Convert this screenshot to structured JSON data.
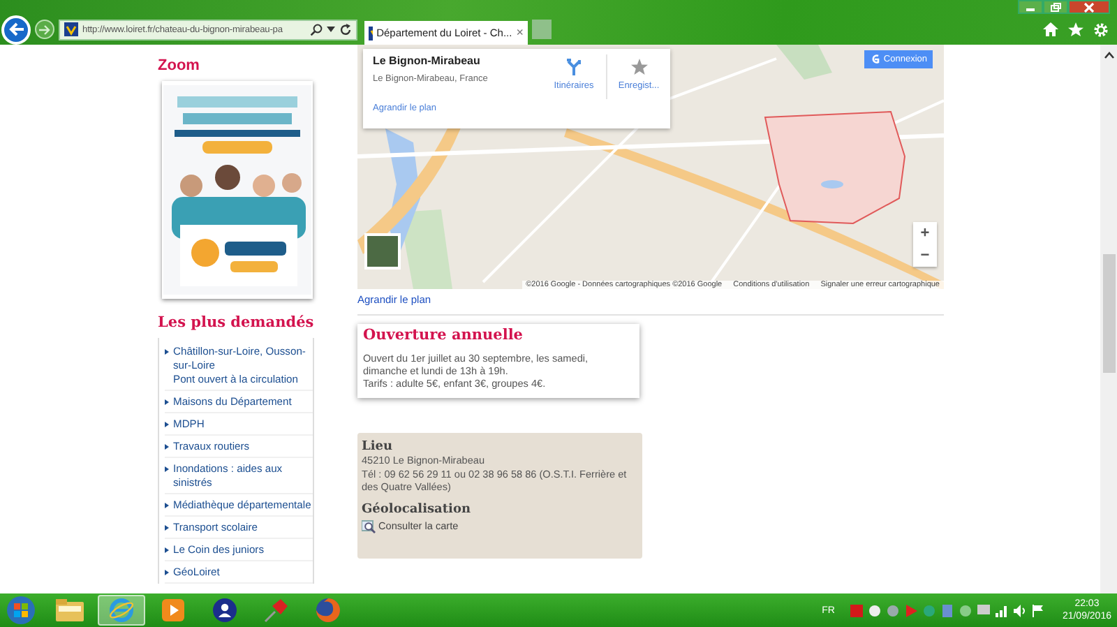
{
  "browser": {
    "address": "http://www.loiret.fr/chateau-du-bignon-mirabeau-pa",
    "tab_title": "Département du Loiret - Ch...",
    "tab_close": "×"
  },
  "sidebar": {
    "zoom_heading": "Zoom",
    "popular_heading": "Les plus demandés",
    "popular_items": [
      {
        "text": "Châtillon-sur-Loire, Ousson-sur-Loire",
        "subtext": "Pont ouvert à la circulation"
      },
      {
        "text": "Maisons du Département"
      },
      {
        "text": "MDPH"
      },
      {
        "text": "Travaux routiers"
      },
      {
        "text": "Inondations : aides aux sinistrés"
      },
      {
        "text": "Médiathèque départementale"
      },
      {
        "text": "Transport scolaire"
      },
      {
        "text": "Le Coin des juniors"
      },
      {
        "text": "GéoLoiret"
      }
    ]
  },
  "map": {
    "place_card": {
      "title": "Le Bignon-Mirabeau",
      "address": "Le Bignon-Mirabeau, France",
      "directions": "Itinéraires",
      "save": "Enregist...",
      "enlarge": "Agrandir le plan"
    },
    "sign_in": "Connexion",
    "zoom_in": "+",
    "zoom_out": "−",
    "attribution": [
      "©2016 Google - Données cartographiques ©2016 Google",
      "Conditions d'utilisation",
      "Signaler une erreur cartographique"
    ]
  },
  "enlarge_link": "Agrandir le plan",
  "opening": {
    "title": "Ouverture annuelle",
    "paragraphs": [
      "Ouvert du 1er juillet au 30 septembre, les samedi, dimanche et lundi de 13h à 19h.",
      "Tarifs : adulte 5€, enfant 3€, groupes 4€."
    ]
  },
  "place": {
    "heading": "Lieu",
    "lines": [
      "45210 Le Bignon-Mirabeau",
      "Tél : 09 62 56 29 11 ou 02 38 96 58 86 (O.S.T.I. Ferrière et des Quatre Vallées)"
    ],
    "geo_heading": "Géolocalisation",
    "map_link": "Consulter la carte"
  },
  "taskbar": {
    "apps": [
      {
        "kind": "folder",
        "selected": false
      },
      {
        "kind": "browser",
        "selected": true
      },
      {
        "kind": "media",
        "selected": false
      },
      {
        "kind": "contact",
        "selected": false
      },
      {
        "kind": "pin",
        "selected": false
      },
      {
        "kind": "firefox",
        "selected": false
      }
    ],
    "language": "FR",
    "time": "22:03",
    "date": "21/09/2016"
  }
}
